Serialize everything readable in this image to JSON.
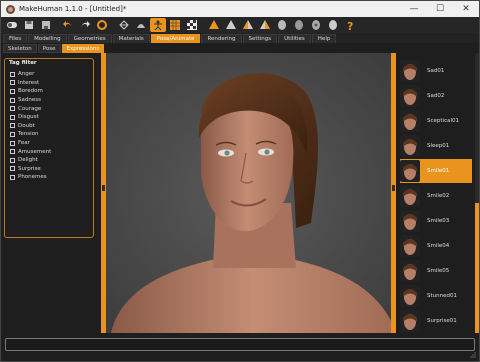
{
  "window": {
    "title": "MakeHuman 1.1.0 - [Untitled]*"
  },
  "window_controls": {
    "minimize": "—",
    "maximize": "☐",
    "close": "✕"
  },
  "toolbar": {
    "icons": [
      "toggle-icon",
      "save-icon",
      "export-icon",
      "undo-icon",
      "redo-icon",
      "reset-icon",
      "wireframe-icon",
      "smooth-icon",
      "pose-icon",
      "grid-icon",
      "checker-icon",
      "front-view-icon",
      "back-view-icon",
      "left-view-icon",
      "right-view-icon",
      "top-view-icon",
      "bottom-view-icon",
      "reset-camera-icon",
      "help-icon"
    ]
  },
  "main_tabs": [
    {
      "label": "Files",
      "active": false
    },
    {
      "label": "Modelling",
      "active": false
    },
    {
      "label": "Geometries",
      "active": false
    },
    {
      "label": "Materials",
      "active": false
    },
    {
      "label": "Pose/Animate",
      "active": true
    },
    {
      "label": "Rendering",
      "active": false
    },
    {
      "label": "Settings",
      "active": false
    },
    {
      "label": "Utilities",
      "active": false
    },
    {
      "label": "Help",
      "active": false
    }
  ],
  "sub_tabs": [
    {
      "label": "Skeleton",
      "active": false
    },
    {
      "label": "Pose",
      "active": false
    },
    {
      "label": "Expressions",
      "active": true
    }
  ],
  "tag_filter": {
    "title": "Tag filter",
    "tags": [
      "Anger",
      "Interest",
      "Boredom",
      "Sadness",
      "Courage",
      "Disgust",
      "Doubt",
      "Tension",
      "Fear",
      "Amusement",
      "Delight",
      "Surprise",
      "Phonemes"
    ]
  },
  "expressions": {
    "items": [
      {
        "label": "Sad01",
        "selected": false
      },
      {
        "label": "Sad02",
        "selected": false
      },
      {
        "label": "Sceptical01",
        "selected": false
      },
      {
        "label": "Sleep01",
        "selected": false
      },
      {
        "label": "Smile01",
        "selected": true
      },
      {
        "label": "Smile02",
        "selected": false
      },
      {
        "label": "Smile03",
        "selected": false
      },
      {
        "label": "Smile04",
        "selected": false
      },
      {
        "label": "Smile05",
        "selected": false
      },
      {
        "label": "Stunned01",
        "selected": false
      },
      {
        "label": "Surprise01",
        "selected": false
      }
    ]
  },
  "colors": {
    "accent": "#e8941f",
    "background": "#1e1e1e",
    "viewport": "#4a4a4a"
  }
}
